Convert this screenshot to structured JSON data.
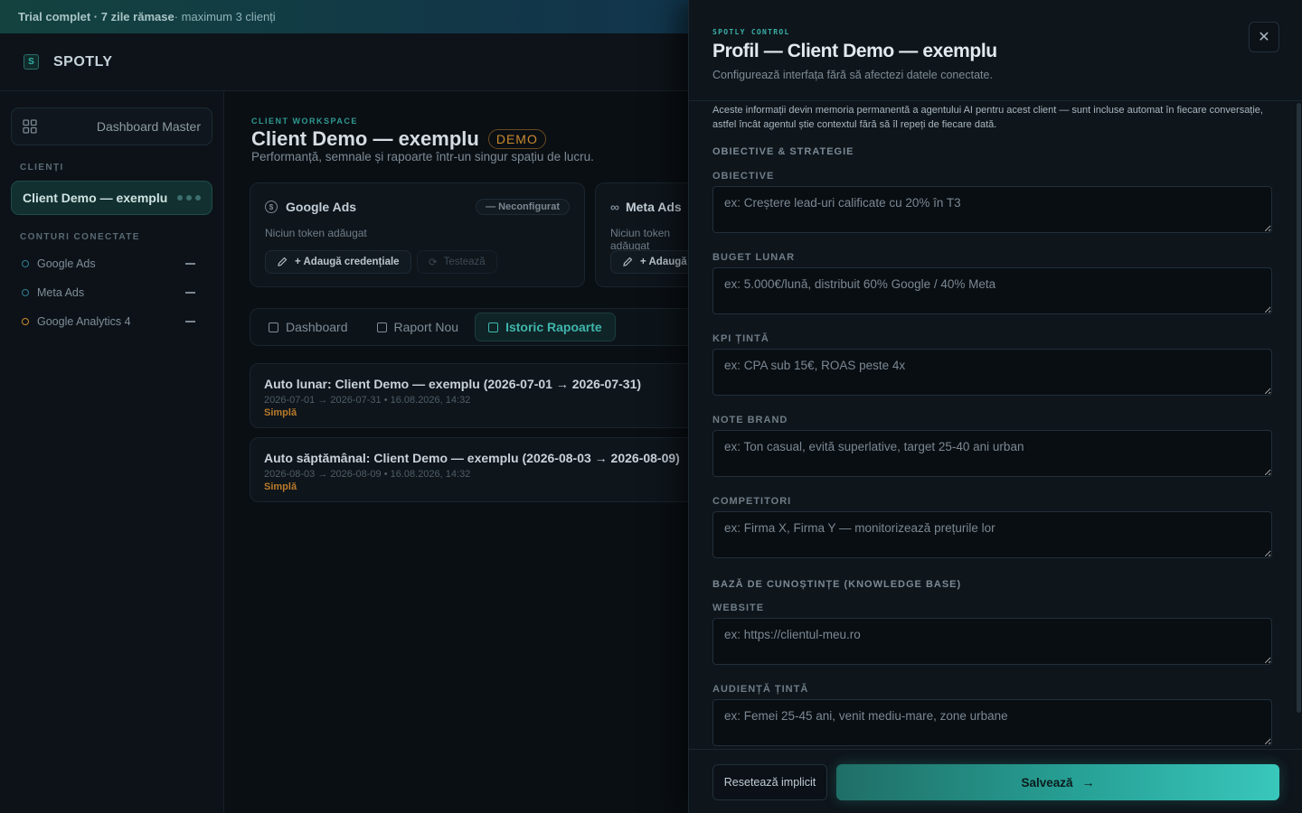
{
  "banner": {
    "bold": "Trial complet · 7 zile rămase",
    "rest": " · maximum 3 clienți"
  },
  "app": {
    "logo_letter": "S",
    "name": "SPOTLY"
  },
  "sidebar": {
    "dashboard_master": "Dashboard Master",
    "clients_label": "CLIENȚI",
    "client_name": "Client Demo — exemplu",
    "accounts_label": "CONTURI CONECTATE",
    "accounts": [
      {
        "label": "Google Ads",
        "dot_color": "#2f7f93"
      },
      {
        "label": "Meta Ads",
        "dot_color": "#2f7f93"
      },
      {
        "label": "Google Analytics 4",
        "dot_color": "#c98a2e"
      }
    ]
  },
  "workspace": {
    "eyebrow": "CLIENT WORKSPACE",
    "title": "Client Demo — exemplu",
    "badge": "DEMO",
    "subtitle": "Performanță, semnale și rapoarte într-un singur spațiu de lucru."
  },
  "cards": [
    {
      "name": "Google Ads",
      "status": "— Neconfigurat",
      "sub": "Niciun token adăugat",
      "add_label": "+ Adaugă credențiale",
      "test_label": "Testează"
    },
    {
      "name": "Meta Ads",
      "sub": "Niciun token adăugat",
      "add_label": "+ Adaugă"
    }
  ],
  "tabs": [
    {
      "label": "Dashboard",
      "active": false
    },
    {
      "label": "Raport Nou",
      "active": false
    },
    {
      "label": "Istoric Rapoarte",
      "active": true
    }
  ],
  "reports": [
    {
      "title": "Auto lunar: Client Demo — exemplu (2026-07-01 → 2026-07-31)",
      "meta": "2026-07-01 → 2026-07-31 • 16.08.2026, 14:32",
      "type": "Simplă"
    },
    {
      "title": "Auto săptămânal: Client Demo — exemplu (2026-08-03 → 2026-08-09)",
      "meta": "2026-08-03 → 2026-08-09 • 16.08.2026, 14:32",
      "type": "Simplă"
    }
  ],
  "panel": {
    "eyebrow": "SPOTLY CONTROL",
    "title": "Profil — Client Demo — exemplu",
    "subtitle": "Configurează interfața fără să afectezi datele conectate.",
    "close": "✕",
    "intro": "Aceste informații devin memoria permanentă a agentului AI pentru acest client — sunt incluse automat în fiecare conversație, astfel încât agentul știe contextul fără să îl repeți de fiecare dată.",
    "section1": "OBIECTIVE & STRATEGIE",
    "fields1": [
      {
        "label": "OBIECTIVE",
        "placeholder": "ex: Creștere lead-uri calificate cu 20% în T3",
        "value": ""
      },
      {
        "label": "BUGET LUNAR",
        "placeholder": "ex: 5.000€/lună, distribuit 60% Google / 40% Meta",
        "value": ""
      },
      {
        "label": "KPI ȚINTĂ",
        "placeholder": "ex: CPA sub 15€, ROAS peste 4x",
        "value": ""
      },
      {
        "label": "NOTE BRAND",
        "placeholder": "ex: Ton casual, evită superlative, target 25-40 ani urban",
        "value": ""
      },
      {
        "label": "COMPETITORI",
        "placeholder": "ex: Firma X, Firma Y — monitorizează prețurile lor",
        "value": ""
      }
    ],
    "section2": "BAZĂ DE CUNOȘTINȚE (KNOWLEDGE BASE)",
    "fields2": [
      {
        "label": "WEBSITE",
        "placeholder": "ex: https://clientul-meu.ro",
        "value": ""
      },
      {
        "label": "AUDIENȚĂ ȚINTĂ",
        "placeholder": "ex: Femei 25-45 ani, venit mediu-mare, zone urbane",
        "value": ""
      }
    ],
    "reset_label": "Resetează implicit",
    "save_label": "Salvează",
    "save_arrow": "→"
  },
  "colors": {
    "accent": "#39c7bc",
    "warning": "#c98a2e",
    "panel_bg": "#0e151b"
  }
}
